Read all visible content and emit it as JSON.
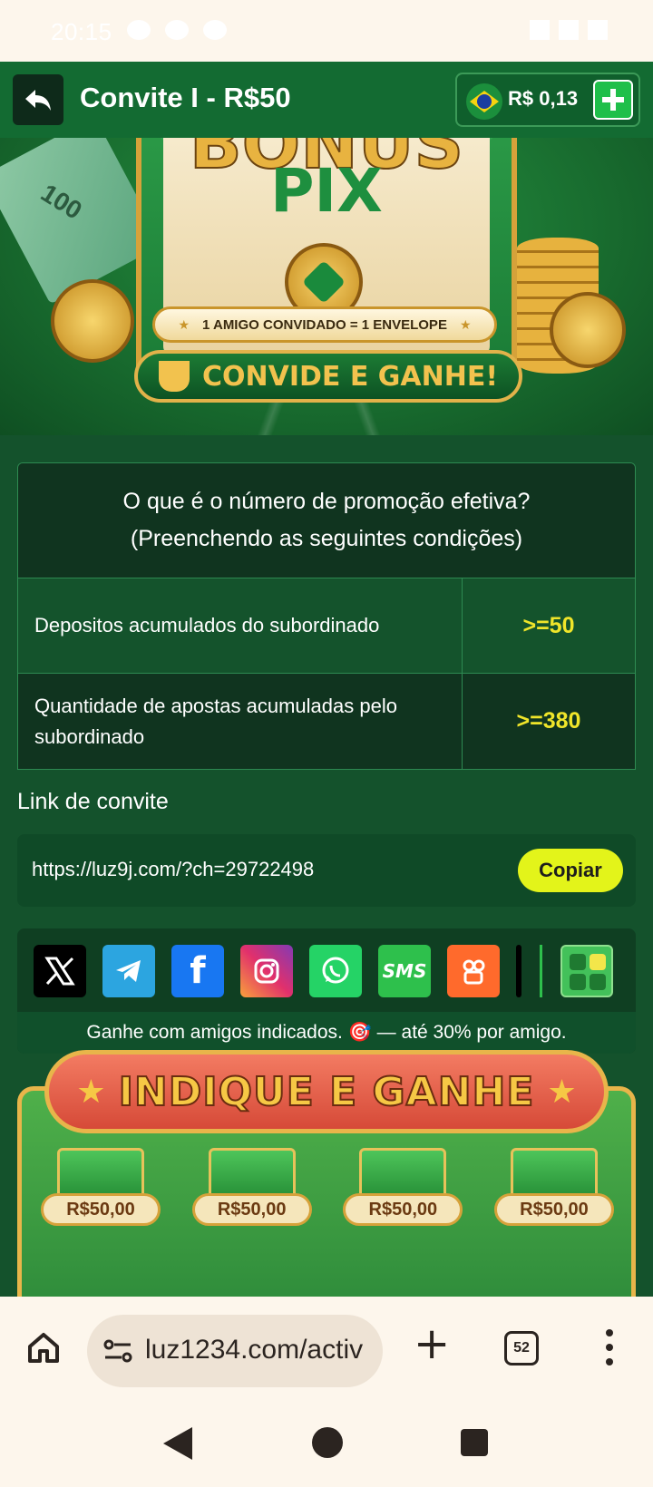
{
  "status_bar": {
    "time": "20:15"
  },
  "header": {
    "title": "Convite I - R$50",
    "balance": "R$ 0,13",
    "back_icon": "back-arrow-icon",
    "add_icon": "plus-icon"
  },
  "banner": {
    "title_top": "BONUS",
    "title_bottom": "PIX",
    "pill_text": "1 AMIGO CONVIDADO = 1 ENVELOPE",
    "cta_text": "CONVIDE E GANHE!",
    "bills_text": "100"
  },
  "promo": {
    "heading_line1": "O que é o número de promoção efetiva?",
    "heading_line2": "(Preenchendo as seguintes condições)",
    "rows": [
      {
        "label": "Depositos acumulados do subordinado",
        "value": ">=50"
      },
      {
        "label": "Quantidade de apostas acumuladas pelo subordinado",
        "value": ">=380"
      }
    ]
  },
  "invite": {
    "label": "Link de convite",
    "url": "https://luz9j.com/?ch=29722498",
    "copy_label": "Copiar"
  },
  "share": {
    "icons": [
      "x-icon",
      "telegram-icon",
      "facebook-icon",
      "instagram-icon",
      "whatsapp-icon",
      "sms-icon",
      "kwai-icon",
      "more-apps-icon"
    ],
    "sms_label": "SMS",
    "footer_text": "Ganhe com amigos indicados. 🎯 — até 30% por amigo."
  },
  "indique": {
    "title": "INDIQUE E GANHE",
    "prizes": [
      "R$50,00",
      "R$50,00",
      "R$50,00",
      "R$50,00"
    ]
  },
  "browser": {
    "url": "luz1234.com/activ",
    "tab_count": "52"
  },
  "colors": {
    "header_green": "#136b32",
    "page_green": "#14522c",
    "accent_yellow": "#e3f41a",
    "value_yellow": "#f0e52a"
  }
}
